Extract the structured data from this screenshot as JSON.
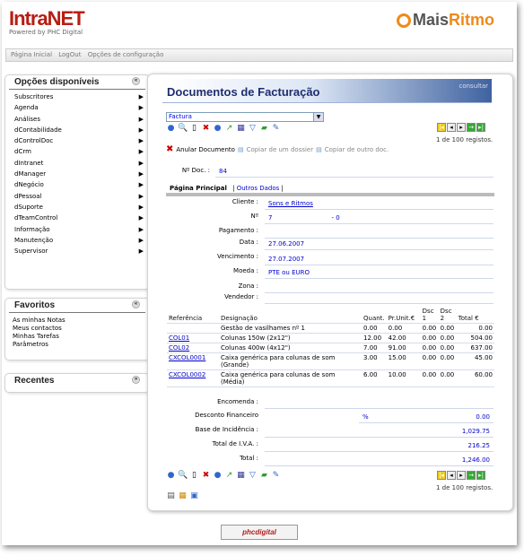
{
  "brand": {
    "name": "IntraNET",
    "tagline": "Powered by PHC Digital",
    "partner_a": "Mais",
    "partner_b": "Ritmo"
  },
  "topnav": [
    "Página Inicial",
    "LogOut",
    "Opções de configuração"
  ],
  "sidebar": {
    "title": "Opções disponíveis",
    "items": [
      "Subscritores",
      "Agenda",
      "Análises",
      "dContabilidade",
      "dControlDoc",
      "dCrm",
      "dIntranet",
      "dManager",
      "dNegócio",
      "dPessoal",
      "dSuporte",
      "dTeamControl",
      "Informação",
      "Manutenção",
      "Supervisor"
    ]
  },
  "favorites": {
    "title": "Favoritos",
    "items": [
      "As minhas Notas",
      "Meus contactos",
      "Minhas Tarefas",
      "Parâmetros"
    ]
  },
  "recent": {
    "title": "Recentes"
  },
  "page": {
    "title": "Documentos de Facturação",
    "corner": "consultar",
    "doc_type": "Factura",
    "record_count": "1 de 100 registos.",
    "actions": {
      "cancel": "Anular Documento",
      "copy_dossier": "Copiar de um dossier",
      "copy_other": "Copiar de outro doc."
    }
  },
  "doc": {
    "num_label": "Nº Doc. :",
    "num": "84"
  },
  "tabs": {
    "main": "Página Principal",
    "other": "Outros Dados"
  },
  "fields": {
    "cliente_label": "Cliente :",
    "cliente": "Sons e Ritmos",
    "n_label": "Nº",
    "n": "7",
    "n2": "- 0",
    "pag_label": "Pagamento :",
    "data_label": "Data :",
    "data": "27.06.2007",
    "venc_label": "Vencimento :",
    "venc": "27.07.2007",
    "moeda_label": "Moeda :",
    "moeda": "PTE ou EURO",
    "zona_label": "Zona :",
    "vend_label": "Vendedor :"
  },
  "lines": {
    "headers": {
      "ref": "Referência",
      "desig": "Designação",
      "qty": "Quant.",
      "price": "Pr.Unit.€",
      "d1": "Dsc 1",
      "d2": "Dsc 2",
      "total": "Total €"
    },
    "rows": [
      {
        "ref": "",
        "desig": "Gestão de vasilhames nº 1",
        "qty": "0.00",
        "price": "0.00",
        "d1": "0.00",
        "d2": "0.00",
        "total": "0.00"
      },
      {
        "ref": "COL01",
        "desig": "Colunas 150w (2x12\")",
        "qty": "12.00",
        "price": "42.00",
        "d1": "0.00",
        "d2": "0.00",
        "total": "504.00"
      },
      {
        "ref": "COL02",
        "desig": "Colunas 400w (4x12\")",
        "qty": "7.00",
        "price": "91.00",
        "d1": "0.00",
        "d2": "0.00",
        "total": "637.00"
      },
      {
        "ref": "CXCOL0001",
        "desig": "Caixa genérica para colunas de som (Grande)",
        "qty": "3.00",
        "price": "15.00",
        "d1": "0.00",
        "d2": "0.00",
        "total": "45.00"
      },
      {
        "ref": "CXCOL0002",
        "desig": "Caixa genérica para colunas de som (Média)",
        "qty": "6.00",
        "price": "10.00",
        "d1": "0.00",
        "d2": "0.00",
        "total": "60.00"
      }
    ]
  },
  "totals": {
    "enc_label": "Encomenda :",
    "desc_label": "Desconto Financeiro",
    "desc_pct": "%",
    "desc": "0.00",
    "base_label": "Base de Incidência :",
    "base": "1,029.75",
    "iva_label": "Total de I.V.A. :",
    "iva": "216.25",
    "total_label": "Total :",
    "total": "1,246.00"
  },
  "footer": {
    "logo": "phcdigital"
  },
  "colors": {
    "brand_red": "#b81d13",
    "accent_orange": "#ef8a1a",
    "title_blue": "#1e2e6e",
    "link_blue": "#0000cc"
  }
}
